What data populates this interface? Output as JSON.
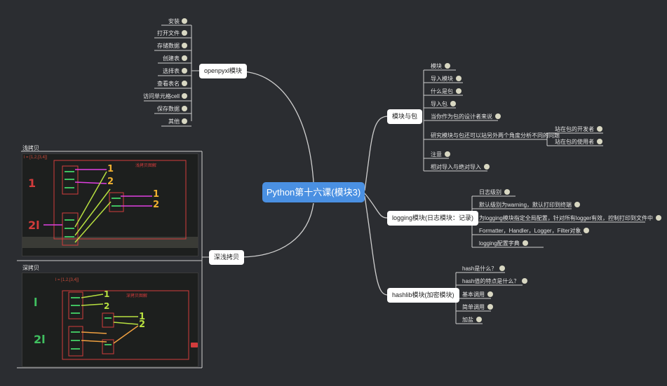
{
  "central": {
    "label": "Python第十六课(模块3)"
  },
  "openpyxl": {
    "label": "openpyxl模块",
    "items": [
      "安装",
      "打开文件",
      "存储数据",
      "创建表",
      "选择表",
      "查看表名",
      "访问单元格cell",
      "保存数据",
      "其他"
    ]
  },
  "copy": {
    "label": "深浅拷贝",
    "shallow": {
      "title": "浅拷贝",
      "code": "l = [1,2,[3,4]]",
      "caption": "浅拷贝图解",
      "num_left_top": "1",
      "num_left_bottom": "2l",
      "num_a": "1",
      "num_b": "2",
      "num_c": "1",
      "num_d": "2"
    },
    "deep": {
      "title": "深拷贝",
      "code": "l = [1,2,[3,4]]",
      "caption": "深拷贝图解",
      "num_left_top": "l",
      "num_left_bottom": "2l",
      "num_a": "1",
      "num_b": "2",
      "num_c": "1",
      "num_d": "2"
    }
  },
  "package": {
    "label": "模块与包",
    "items": [
      "模块",
      "导入模块",
      "什么是包",
      "导入包",
      "当你作为包的设计者来说",
      "研究模块与包还可以站另外两个角度分析不同的问题",
      "注意",
      "相对导入与绝对导入"
    ],
    "sub": [
      "站在包的开发者",
      "站在包的使用者"
    ]
  },
  "logging": {
    "label": "logging模块(日志模块：记录)",
    "items": [
      "日志级别",
      "默认级别为warning，默认打印到终端",
      "为logging模块指定全局配置，针对所有logger有效，控制打印到文件中",
      "Formatter，Handler，Logger，Filter对象",
      "logging配置字典"
    ]
  },
  "hashlib": {
    "label": "hashlib模块(加密模块)",
    "items": [
      "hash是什么？",
      "hash值的特点是什么？",
      "基本调用",
      "简单调用",
      "加盐"
    ]
  },
  "colors": {
    "background": "#2b2d31",
    "central": "#4a90e2",
    "line": "#c9c9c9",
    "branch": "#ffffff"
  }
}
